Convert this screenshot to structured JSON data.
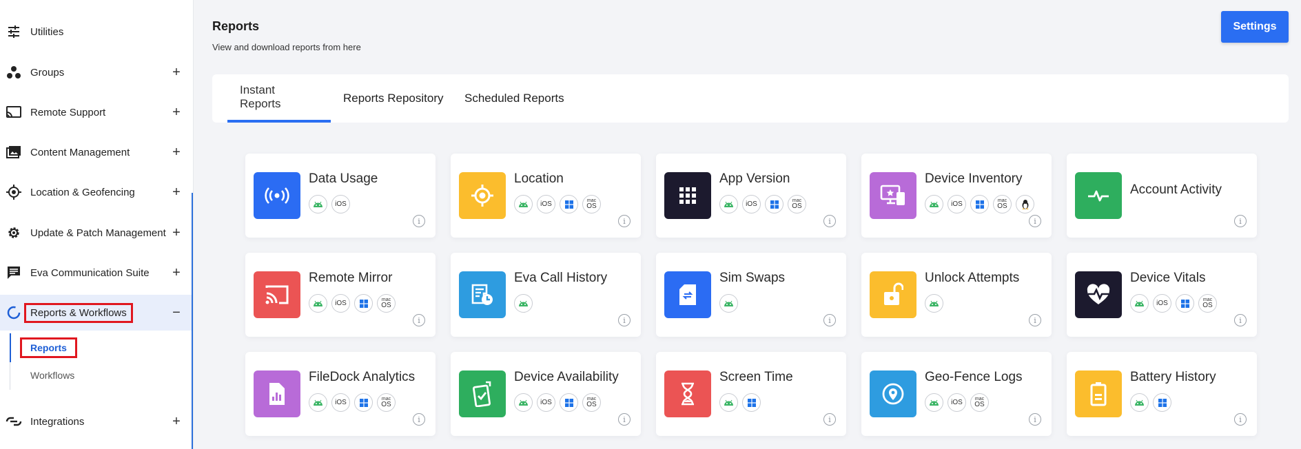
{
  "sidebar": {
    "items": [
      {
        "label": "Utilities",
        "icon": "sliders-icon",
        "expander": ""
      },
      {
        "label": "Groups",
        "icon": "groups-icon",
        "expander": "+"
      },
      {
        "label": "Remote Support",
        "icon": "cast-icon",
        "expander": "+"
      },
      {
        "label": "Content Management",
        "icon": "photo-library-icon",
        "expander": "+"
      },
      {
        "label": "Location & Geofencing",
        "icon": "location-target-icon",
        "expander": "+"
      },
      {
        "label": "Update & Patch Management",
        "icon": "gear-icon",
        "expander": "+"
      },
      {
        "label": "Eva Communication Suite",
        "icon": "chat-icon",
        "expander": "+"
      },
      {
        "label": "Reports & Workflows",
        "icon": "reports-ring-icon",
        "expander": "−"
      },
      {
        "label": "Integrations",
        "icon": "integrations-icon",
        "expander": "+"
      }
    ],
    "sub_items": [
      {
        "label": "Reports"
      },
      {
        "label": "Workflows"
      }
    ]
  },
  "header": {
    "title": "Reports",
    "subtitle": "View and download reports from here",
    "settings_label": "Settings"
  },
  "tabs": [
    {
      "label": "Instant Reports"
    },
    {
      "label": "Reports Repository"
    },
    {
      "label": "Scheduled Reports"
    }
  ],
  "os_labels": {
    "ios": "iOS",
    "mac_top": "mac",
    "mac_bottom": "OS"
  },
  "info_glyph": "i",
  "colors": {
    "accent": "#2a6ef2",
    "blue": "#2b6cf3",
    "yellow": "#fbbd2d",
    "dark": "#1c1a2e",
    "purple": "#b86bd8",
    "green": "#2eae5e",
    "red": "#eb5454",
    "skyblue": "#2e9ce0",
    "android": "#3bb565",
    "windows": "#1e73e8"
  },
  "cards": [
    {
      "title": "Data Usage",
      "icon": "broadcast-icon",
      "color": "blue",
      "os": [
        "android",
        "ios"
      ]
    },
    {
      "title": "Location",
      "icon": "location-crosshair-icon",
      "color": "yellow",
      "os": [
        "android",
        "ios",
        "windows",
        "macos"
      ]
    },
    {
      "title": "App Version",
      "icon": "app-grid-icon",
      "color": "dark",
      "os": [
        "android",
        "ios",
        "windows",
        "macos"
      ]
    },
    {
      "title": "Device Inventory",
      "icon": "device-inventory-icon",
      "color": "purple",
      "os": [
        "android",
        "ios",
        "windows",
        "macos",
        "linux"
      ]
    },
    {
      "title": "Account Activity",
      "icon": "activity-pulse-icon",
      "color": "green",
      "os": []
    },
    {
      "title": "Remote Mirror",
      "icon": "cast-icon",
      "color": "red",
      "os": [
        "android",
        "ios",
        "windows",
        "macos"
      ]
    },
    {
      "title": "Eva Call History",
      "icon": "call-history-icon",
      "color": "skyblue",
      "os": [
        "android"
      ]
    },
    {
      "title": "Sim Swaps",
      "icon": "sim-swap-icon",
      "color": "blue",
      "os": [
        "android"
      ]
    },
    {
      "title": "Unlock Attempts",
      "icon": "unlock-icon",
      "color": "yellow",
      "os": [
        "android"
      ]
    },
    {
      "title": "Device Vitals",
      "icon": "heart-pulse-icon",
      "color": "dark",
      "os": [
        "android",
        "ios",
        "windows",
        "macos"
      ]
    },
    {
      "title": "FileDock Analytics",
      "icon": "file-chart-icon",
      "color": "purple",
      "os": [
        "android",
        "ios",
        "windows",
        "macos"
      ]
    },
    {
      "title": "Device Availability",
      "icon": "device-check-icon",
      "color": "green",
      "os": [
        "android",
        "ios",
        "windows",
        "macos"
      ]
    },
    {
      "title": "Screen Time",
      "icon": "hourglass-icon",
      "color": "red",
      "os": [
        "android",
        "windows"
      ]
    },
    {
      "title": "Geo-Fence Logs",
      "icon": "map-pin-icon",
      "color": "skyblue",
      "os": [
        "android",
        "ios",
        "macos"
      ]
    },
    {
      "title": "Battery History",
      "icon": "battery-icon",
      "color": "yellow",
      "os": [
        "android",
        "windows"
      ]
    }
  ]
}
